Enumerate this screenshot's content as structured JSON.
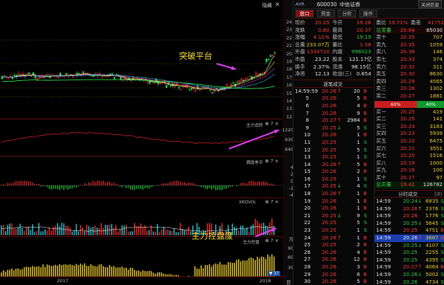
{
  "top_right_label": "隐藏",
  "top_right_close": "×",
  "price_axis": [
    "24",
    "23",
    "22",
    "21",
    "20",
    "19",
    "18",
    "17",
    "16",
    "15",
    "14",
    "13",
    "12"
  ],
  "annotation_breakout": "突破平台",
  "annotation_control": "主力控盘度",
  "panels": [
    {
      "title": "主力追踪",
      "controls": "⊕ ? ×",
      "axis": [
        "1220",
        "930",
        "640"
      ]
    },
    {
      "title": "猜股季节",
      "controls": "⊕ ? ×",
      "axis": [
        "4",
        "2",
        "0",
        "-2",
        "-4"
      ]
    },
    {
      "title": "KKDVOL",
      "controls": "⊕ ? ×",
      "axis": [
        "万"
      ]
    },
    {
      "title": "主力控盘",
      "controls": "⊕ ? ×",
      "axis": [
        "90",
        "60",
        "30"
      ]
    }
  ],
  "bottom": {
    "year_left": "2017",
    "year_right": "2018",
    "page_indicator": "▼ 37",
    "nav_label": "日 线"
  },
  "header": {
    "market": "AHR",
    "code": "600030",
    "name": "中信证券",
    "button": "关闭信息"
  },
  "tabs": [
    "盘口",
    "资金",
    "分析",
    "操作"
  ],
  "stats": [
    {
      "l1": "现价",
      "v1": "20.25",
      "l2": "今开",
      "v2": "19.26",
      "c1": "red",
      "c2": "red"
    },
    {
      "l1": "涨跌",
      "v1": "0.80",
      "l2": "最高",
      "v2": "20.37",
      "c1": "red",
      "c2": "red"
    },
    {
      "l1": "涨幅",
      "v1": "4.11%",
      "l2": "最低",
      "v2": "19.19",
      "c1": "red",
      "c2": "grn"
    },
    {
      "l1": "总量",
      "v1": "233.07万",
      "l2": "量比",
      "v2": "1.58",
      "c1": "yel",
      "c2": "red"
    },
    {
      "l1": "外盘",
      "v1": "1334710",
      "l2": "内盘",
      "v2": "996023",
      "c1": "red",
      "c2": "grn"
    },
    {
      "l1": "市盈",
      "v1": "23.22",
      "l2": "股本",
      "v2": "121.17亿",
      "c1": "wht",
      "c2": "wht"
    },
    {
      "l1": "换手",
      "v1": "2.37%",
      "l2": "流通",
      "v2": "98.15亿",
      "c1": "wht",
      "c2": "wht"
    },
    {
      "l1": "净资",
      "v1": "12.13",
      "l2": "收益(三)",
      "v2": "0.654",
      "c1": "wht",
      "c2": "wht"
    }
  ],
  "ratio": {
    "l1": "委比",
    "v1": "19.71%",
    "l2": "委差",
    "v2": "41752"
  },
  "total_sell": {
    "label": "总卖量",
    "price": "20.84",
    "vol": "85030"
  },
  "asks": [
    {
      "label": "卖十",
      "price": "20.35",
      "vol": "707"
    },
    {
      "label": "卖九",
      "price": "20.35",
      "vol": "1059"
    },
    {
      "label": "卖八",
      "price": "20.36",
      "vol": "146"
    },
    {
      "label": "卖七",
      "price": "20.33",
      "vol": "374"
    },
    {
      "label": "卖六",
      "price": "20.32",
      "vol": "311"
    },
    {
      "label": "卖五",
      "price": "20.30",
      "vol": "8630"
    },
    {
      "label": "卖四",
      "price": "20.29",
      "vol": "4565"
    },
    {
      "label": "卖三",
      "price": "20.28",
      "vol": "1302"
    },
    {
      "label": "卖二",
      "price": "20.27",
      "vol": "1881"
    }
  ],
  "bar": {
    "left": "60%",
    "right": "40%",
    "left_pct": 0.6
  },
  "bids": [
    {
      "label": "买一",
      "price": "20.25",
      "vol": "419"
    },
    {
      "label": "买二",
      "price": "20.25",
      "vol": "141"
    },
    {
      "label": "买三",
      "price": "20.24",
      "vol": "3183"
    },
    {
      "label": "买四",
      "price": "20.23",
      "vol": "5939"
    },
    {
      "label": "买五",
      "price": "20.22",
      "vol": "6475"
    },
    {
      "label": "买六",
      "price": "20.21",
      "vol": "3551"
    },
    {
      "label": "买七",
      "price": "20.20",
      "vol": "1516"
    },
    {
      "label": "买八",
      "price": "20.19",
      "vol": "1000"
    },
    {
      "label": "买九",
      "price": "20.18",
      "vol": "100"
    },
    {
      "label": "买十",
      "price": "20.17",
      "vol": "97"
    }
  ],
  "total_buy": {
    "label": "总买量",
    "price": "19.42",
    "vol": "126782"
  },
  "trades_title": "逐笔成交",
  "trades_first_time": "14:59:59",
  "trades": [
    {
      "n": "",
      "p": "20.26",
      "d": "↑",
      "v": "20",
      "s": "B"
    },
    {
      "n": "5",
      "p": "20.26",
      "d": "",
      "v": "5",
      "s": "B"
    },
    {
      "n": "6",
      "p": "20.26",
      "d": "",
      "v": "4",
      "s": "B"
    },
    {
      "n": "7",
      "p": "20.26",
      "d": "",
      "v": "9",
      "s": "B"
    },
    {
      "n": "8",
      "p": "20.27",
      "d": "↑",
      "v": "2984",
      "s": "B"
    },
    {
      "n": "9",
      "p": "20.25",
      "d": "↓",
      "v": "5",
      "s": "S"
    },
    {
      "n": "10",
      "p": "20.26",
      "d": "",
      "v": "1",
      "s": "B"
    },
    {
      "n": "11",
      "p": "20.25",
      "d": "",
      "v": "1",
      "s": "S"
    },
    {
      "n": "12",
      "p": "20.25",
      "d": "",
      "v": "5",
      "s": "S"
    },
    {
      "n": "13",
      "p": "20.25",
      "d": "",
      "v": "1",
      "s": "S"
    },
    {
      "n": "14",
      "p": "20.26",
      "d": "↑",
      "v": "5",
      "s": "B"
    },
    {
      "n": "15",
      "p": "20.26",
      "d": "",
      "v": "2",
      "s": "B"
    },
    {
      "n": "16",
      "p": "20.25",
      "d": "",
      "v": "1",
      "s": "S"
    },
    {
      "n": "17",
      "p": "20.25",
      "d": "↓",
      "v": "4",
      "s": "S"
    },
    {
      "n": "18",
      "p": "20.26",
      "d": "↑",
      "v": "1",
      "s": "B"
    },
    {
      "n": "19",
      "p": "20.26",
      "d": "",
      "v": "1",
      "s": "B"
    },
    {
      "n": "20",
      "p": "20.26",
      "d": "",
      "v": "1",
      "s": "B"
    },
    {
      "n": "21",
      "p": "20.25",
      "d": "↓",
      "v": "9",
      "s": "S"
    },
    {
      "n": "22",
      "p": "20.25",
      "d": "",
      "v": "5",
      "s": "S"
    },
    {
      "n": "23",
      "p": "20.25",
      "d": "",
      "v": "1",
      "s": "S"
    },
    {
      "n": "24",
      "p": "20.26",
      "d": "↑",
      "v": "1",
      "s": "B"
    },
    {
      "n": "25",
      "p": "20.25",
      "d": "",
      "v": "2",
      "s": "B"
    },
    {
      "n": "26",
      "p": "20.26",
      "d": "",
      "v": "4",
      "s": "B"
    },
    {
      "n": "27",
      "p": "20.26",
      "d": "",
      "v": "12",
      "s": "B"
    },
    {
      "n": "28",
      "p": "20.26",
      "d": "",
      "v": "3",
      "s": "B"
    },
    {
      "n": "29",
      "p": "20.26",
      "d": "",
      "v": "6",
      "s": "B"
    },
    {
      "n": "30",
      "p": "20.26",
      "d": "",
      "v": "5",
      "s": "B"
    },
    {
      "n": "31",
      "p": "20.25",
      "d": "",
      "v": "5",
      "s": "B"
    }
  ],
  "minute_title": "分时成交",
  "minute_ctrl": "[详]",
  "minute_trades": [
    {
      "t": "14:59",
      "p": "20.24",
      "d": "↓",
      "v": "6835",
      "s": "S",
      "c": "grn"
    },
    {
      "t": "14:59",
      "p": "20.26",
      "d": "↑",
      "v": "2376",
      "s": "S",
      "c": "red"
    },
    {
      "t": "14:59",
      "p": "20.26",
      "d": "",
      "v": "1776",
      "s": "S",
      "c": "red"
    },
    {
      "t": "14:59",
      "p": "20.25",
      "d": "↓",
      "v": "5645",
      "s": "S",
      "c": "grn"
    },
    {
      "t": "14:59",
      "p": "20.25",
      "d": "",
      "v": "4751",
      "s": "B",
      "c": "red"
    },
    {
      "t": "14:59",
      "p": "20.26",
      "d": "↑",
      "v": "3687",
      "s": "B",
      "c": "wht",
      "hl": true
    },
    {
      "t": "14:59",
      "p": "20.25",
      "d": "↓",
      "v": "4107",
      "s": "S",
      "c": "grn"
    },
    {
      "t": "14:59",
      "p": "20.25",
      "d": "",
      "v": "2255",
      "s": "S",
      "c": "grn"
    },
    {
      "t": "14:59",
      "p": "20.25",
      "d": "",
      "v": "4395",
      "s": "S",
      "c": "grn"
    },
    {
      "t": "14:59",
      "p": "20.27",
      "d": "↑",
      "v": "4064",
      "s": "B",
      "c": "red"
    },
    {
      "t": "14:59",
      "p": "20.26",
      "d": "↓",
      "v": "5002",
      "s": "S",
      "c": "grn"
    },
    {
      "t": "14:59",
      "p": "20.26",
      "d": "",
      "v": "4734",
      "s": "S",
      "c": "grn"
    }
  ]
}
